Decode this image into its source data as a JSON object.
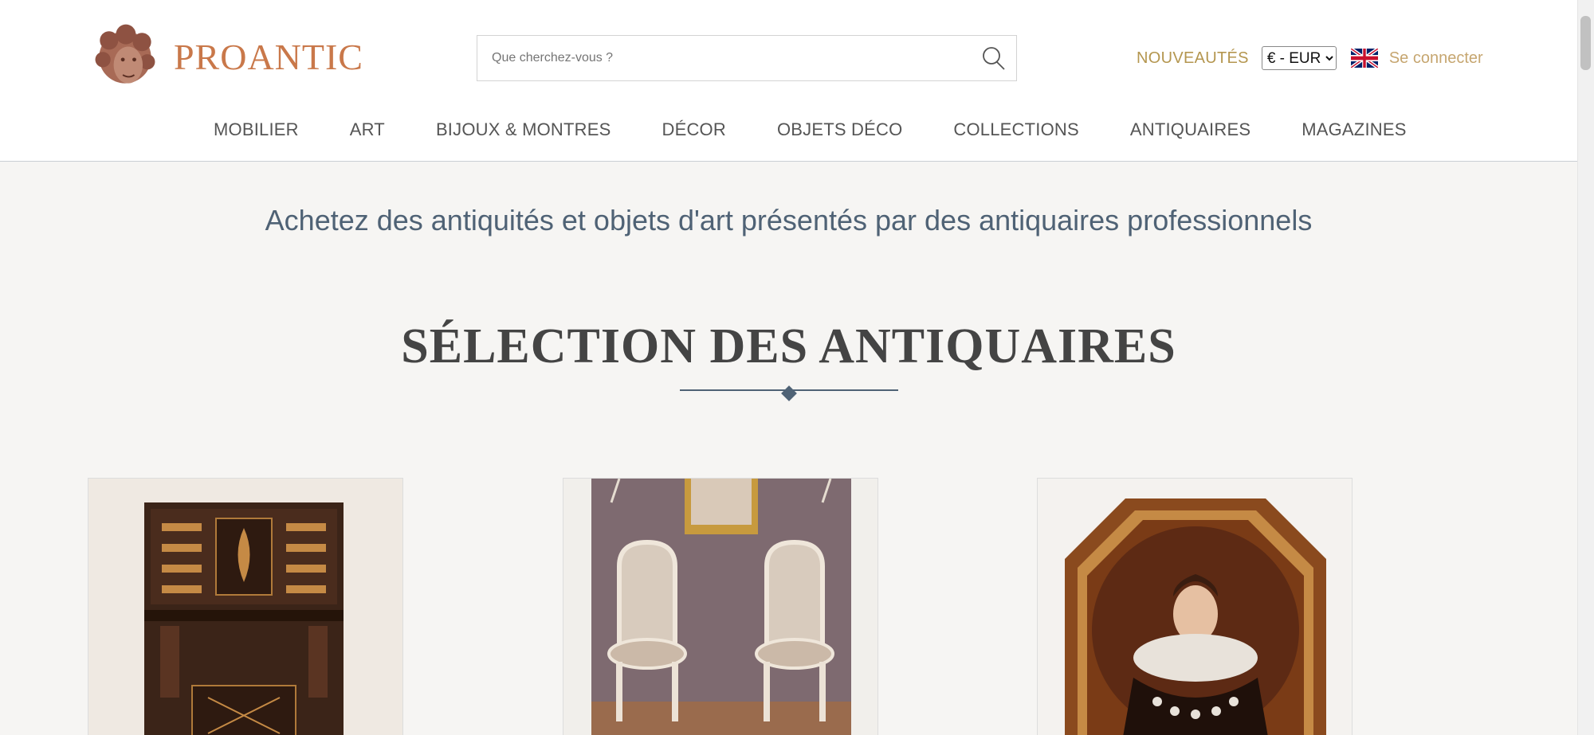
{
  "header": {
    "logo_text": "PROANTIC",
    "search_placeholder": "Que cherchez-vous ?",
    "nouveautes": "NOUVEAUTÉS",
    "currency": "€ - EUR",
    "login": "Se connecter"
  },
  "nav": {
    "items": [
      {
        "label": "MOBILIER"
      },
      {
        "label": "ART"
      },
      {
        "label": "BIJOUX & MONTRES"
      },
      {
        "label": "DÉCOR"
      },
      {
        "label": "OBJETS DÉCO"
      },
      {
        "label": "COLLECTIONS"
      },
      {
        "label": "ANTIQUAIRES"
      },
      {
        "label": "MAGAZINES"
      }
    ]
  },
  "main": {
    "tagline": "Achetez des antiquités et objets d'art présentés par des antiquaires professionnels",
    "section_title": "SÉLECTION DES ANTIQUAIRES"
  },
  "colors": {
    "brand": "#c9784a",
    "accent": "#b4964f",
    "navy": "#4f6275"
  },
  "icons": [
    "search-icon",
    "uk-flag-icon",
    "logo-head-icon"
  ]
}
